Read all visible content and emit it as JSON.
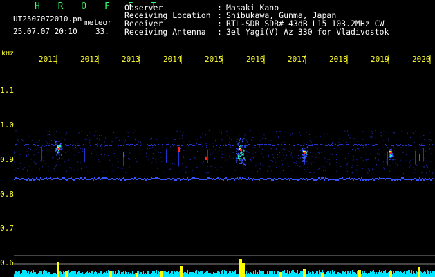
{
  "header": {
    "title": "H R O F F T",
    "filename": "UT2507072010.pn",
    "meteor_label": "meteor",
    "datetime": "25.07.07 20:10",
    "count": "33."
  },
  "meta": {
    "observer_key": "Observer",
    "observer_value": "Masaki Kano",
    "location_key": "Receiving Location",
    "location_value": "Shibukawa, Gunma, Japan",
    "receiver_key": "Receiver",
    "receiver_value": "RTL-SDR SDR# 43dB L15 103.2MHz CW",
    "antenna_key": "Receiving Antenna",
    "antenna_value": "3el Yagi(V) Az 330 for Vladivostok",
    "separator": ":"
  },
  "spectrogram": {
    "y_unit": "kHz",
    "y_ticks": [
      "1.1",
      "1.0",
      "0.9",
      "0.8",
      "0.7",
      "0.6"
    ],
    "x_ticks": [
      "2011",
      "2012",
      "2013",
      "2014",
      "2015",
      "2016",
      "2017",
      "2018",
      "2019",
      "2020"
    ],
    "colors": {
      "background": "#000000",
      "noise": "#2233cc",
      "carrier": "#3355ff",
      "echo_hot": "#ff2222",
      "echo_warm": "#ffff00",
      "echo_cool": "#33ffcc",
      "level_baseline": "#00e5ff",
      "level_peak": "#ffff00",
      "guide_line": "#888888"
    }
  }
}
